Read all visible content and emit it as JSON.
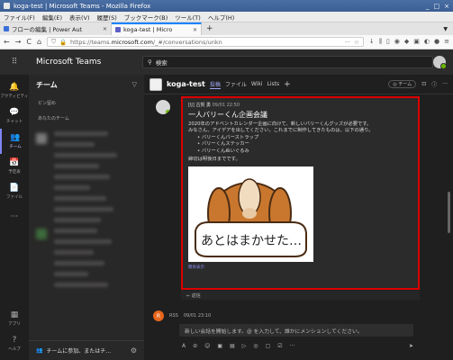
{
  "window": {
    "title": "koga-test | Microsoft Teams - Mozilla Firefox",
    "buttons": [
      "_",
      "□",
      "×"
    ]
  },
  "menubar": [
    "ファイル(F)",
    "編集(E)",
    "表示(V)",
    "履歴(S)",
    "ブックマーク(B)",
    "ツール(T)",
    "ヘルプ(H)"
  ],
  "tabs": [
    {
      "label": "フローの編集 | Power Aut",
      "active": false,
      "favicon_color": "#3a6fd8"
    },
    {
      "label": "koga-test | Micro",
      "active": true,
      "favicon_color": "#5b5fc7"
    }
  ],
  "nav": {
    "back": "←",
    "forward": "→",
    "reload": "C",
    "home": "⌂",
    "url_prefix": "https://teams.",
    "url_domain": "microsoft.com",
    "url_path": "/_#/conversations/unkn",
    "more": "···",
    "bookmark": "☆"
  },
  "teams_header": {
    "app_grid_icon": "⠿",
    "brand": "Microsoft Teams",
    "search_placeholder": "検索"
  },
  "rail": {
    "items": [
      {
        "icon": "🔔",
        "label": "アクティビティ"
      },
      {
        "icon": "💬",
        "label": "チャット"
      },
      {
        "icon": "👥",
        "label": "チーム",
        "active": true
      },
      {
        "icon": "📅",
        "label": "予定表"
      },
      {
        "icon": "📄",
        "label": "ファイル"
      },
      {
        "icon": "···",
        "label": ""
      }
    ],
    "bottom": [
      {
        "icon": "▦",
        "label": "アプリ"
      },
      {
        "icon": "?",
        "label": "ヘルプ"
      }
    ]
  },
  "panel": {
    "title": "チーム",
    "filter_icon": "▽",
    "pinned": "ピン留め",
    "your_teams": "あなたのチーム",
    "join_label": "チームに参加、またはチ…",
    "join_icon": "👥",
    "gear_icon": "⚙"
  },
  "channel": {
    "name": "koga-test",
    "tabs": [
      "投稿",
      "ファイル",
      "Wiki",
      "Lists"
    ],
    "add_tab": "+",
    "team_pill": "◎ チーム",
    "header_icons": [
      "⊡",
      "ⓘ",
      "···"
    ]
  },
  "message": {
    "author": "[IJ] 古賀 勇",
    "time": "09/01 22:50",
    "title": "一人バリーくん企画会議",
    "body_line1": "2020年のアドベントカレンダー企画に向けて、新しいバリーくんグッズが必要です。",
    "body_line2": "みなさん、アイデアを出してください。これまでに制作してきたものは、以下の通り。",
    "bullets": [
      "バリーくんバーストラップ",
      "バリーくんステッカー",
      "バリーくんぬいぐるみ"
    ],
    "deadline": "締切は明後日までです。",
    "image_caption": "あとはまかせた…",
    "show_more": "簡易表示",
    "reply": "← 返信"
  },
  "rss": {
    "icon": "R",
    "name": "RSS",
    "time": "09/01 23:10"
  },
  "compose": {
    "placeholder": "新しい会話を開始します。@ を入力して、誰かにメンションしてください。",
    "tools": [
      "A",
      "⊘",
      "☺",
      "▣",
      "▤",
      "▷",
      "◎",
      "▢",
      "☑",
      "···"
    ],
    "send": "➤"
  }
}
